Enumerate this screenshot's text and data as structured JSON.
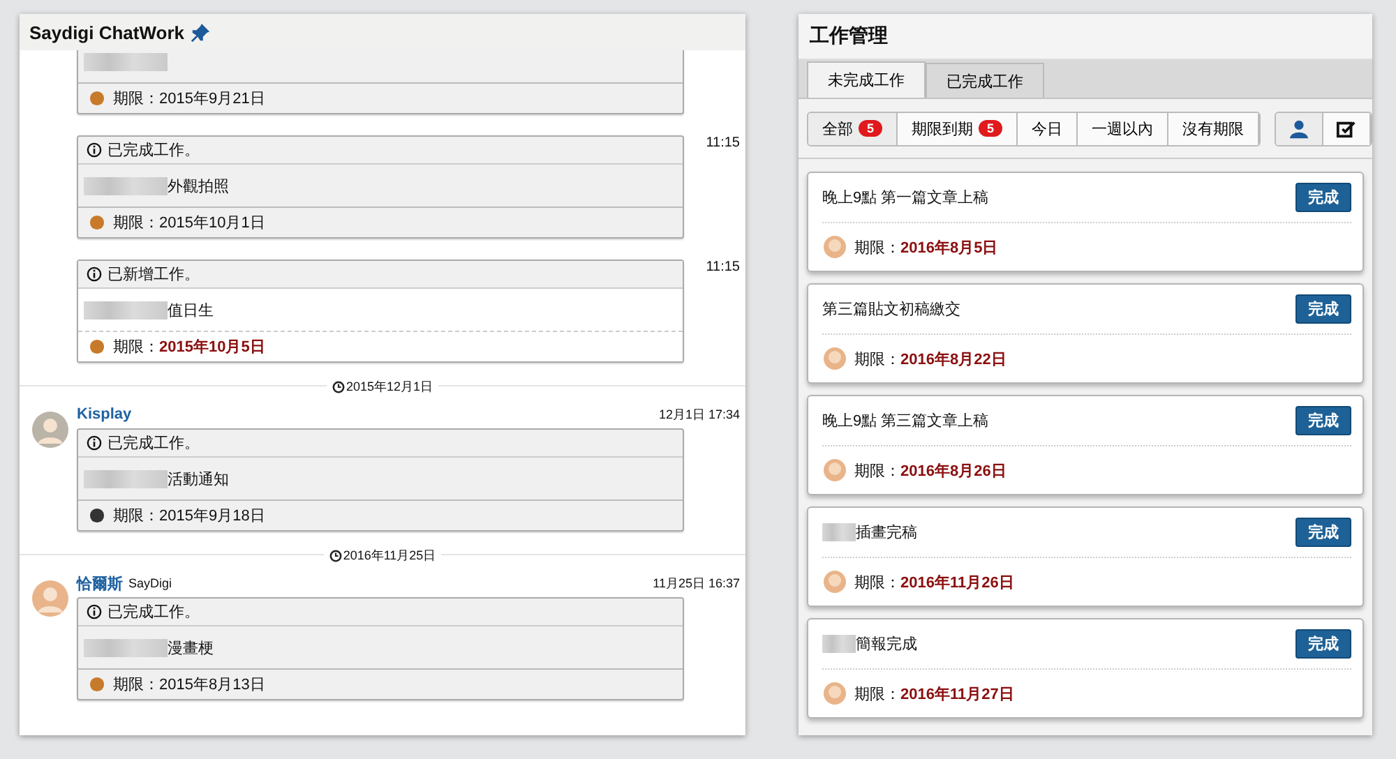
{
  "chat_panel": {
    "title": "Saydigi ChatWork",
    "pinned": true,
    "feed": [
      {
        "kind": "task",
        "card": {
          "completed": true,
          "redacted": true,
          "due_label": "期限：",
          "due": "2015年9月21日",
          "overdue": false
        }
      },
      {
        "kind": "task",
        "time": "11:15",
        "card": {
          "status": "已完成工作。",
          "completed": true,
          "redacted": true,
          "text": "外觀拍照",
          "due_label": "期限：",
          "due": "2015年10月1日",
          "overdue": false
        }
      },
      {
        "kind": "task",
        "time": "11:15",
        "card": {
          "status": "已新增工作。",
          "completed": false,
          "redacted": true,
          "text": "值日生",
          "due_label": "期限：",
          "due": "2015年10月5日",
          "overdue": true
        }
      },
      {
        "kind": "divider",
        "date": "2015年12月1日"
      },
      {
        "kind": "message",
        "sender": "Kisplay",
        "time": "12月1日 17:34",
        "card": {
          "status": "已完成工作。",
          "completed": true,
          "redacted": true,
          "text": "活動通知",
          "due_label": "期限：",
          "due": "2015年9月18日",
          "overdue": false
        }
      },
      {
        "kind": "divider",
        "date": "2016年11月25日"
      },
      {
        "kind": "message",
        "sender": "恰爾斯",
        "org": "SayDigi",
        "time": "11月25日 16:37",
        "card": {
          "status": "已完成工作。",
          "completed": true,
          "redacted": true,
          "text": "漫畫梗",
          "due_label": "期限：",
          "due": "2015年8月13日",
          "overdue": false
        }
      }
    ]
  },
  "task_panel": {
    "title": "工作管理",
    "tabs": [
      {
        "label": "未完成工作",
        "selected": true
      },
      {
        "label": "已完成工作",
        "selected": false
      }
    ],
    "filters": [
      {
        "label": "全部",
        "count": "5",
        "selected": true
      },
      {
        "label": "期限到期",
        "count": "5",
        "selected": false
      },
      {
        "label": "今日",
        "selected": false
      },
      {
        "label": "一週以內",
        "selected": false
      },
      {
        "label": "沒有期限",
        "selected": false
      }
    ],
    "tools": [
      {
        "kind": "person",
        "selected": true
      },
      {
        "kind": "edit",
        "selected": false
      }
    ],
    "tasks": [
      {
        "title": "晚上9點 第一篇文章上稿",
        "button": "完成",
        "due_label": "期限：",
        "due": "2016年8月5日",
        "overdue": true
      },
      {
        "title": "第三篇貼文初稿繳交",
        "button": "完成",
        "due_label": "期限：",
        "due": "2016年8月22日",
        "overdue": true
      },
      {
        "title": "晚上9點 第三篇文章上稿",
        "button": "完成",
        "due_label": "期限：",
        "due": "2016年8月26日",
        "overdue": true
      },
      {
        "redacted": true,
        "title": "插畫完稿",
        "button": "完成",
        "due_label": "期限：",
        "due": "2016年11月26日",
        "overdue": true
      },
      {
        "redacted": true,
        "title": "簡報完成",
        "button": "完成",
        "due_label": "期限：",
        "due": "2016年11月27日",
        "overdue": true
      }
    ]
  }
}
